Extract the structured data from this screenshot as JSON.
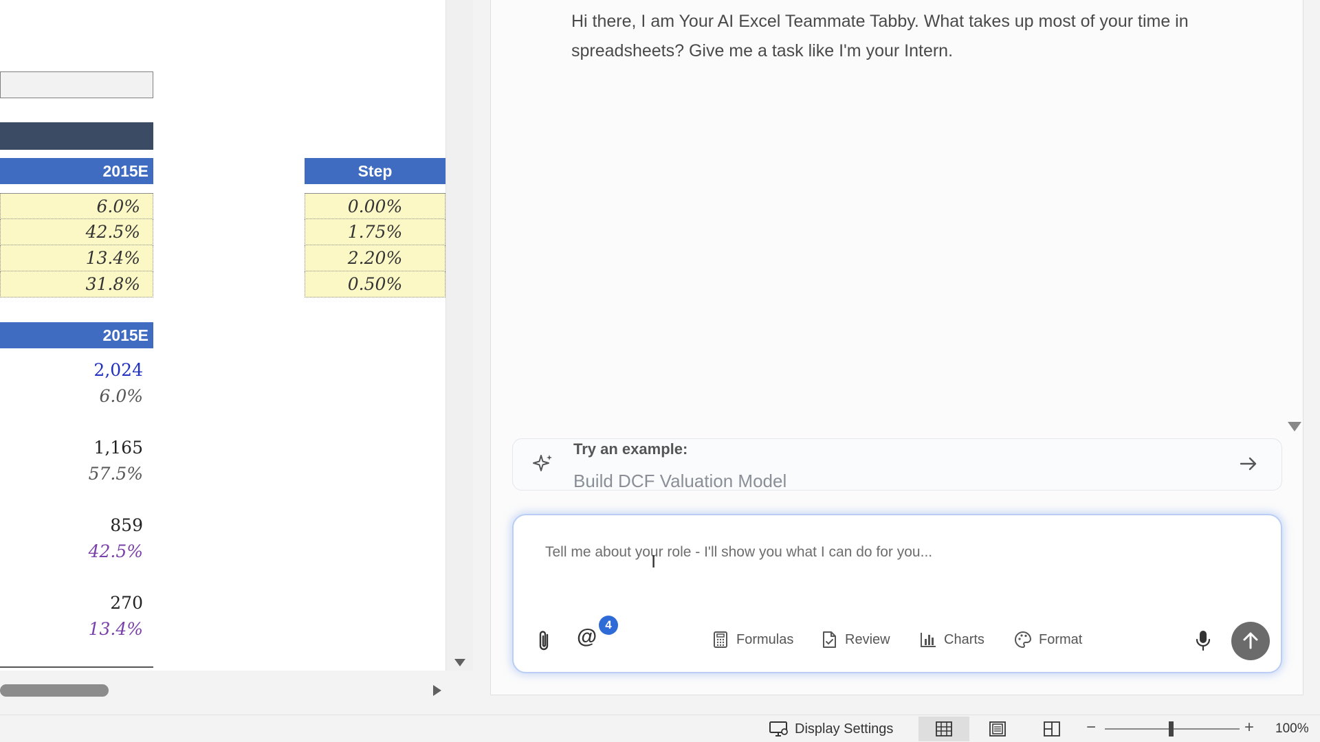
{
  "sheet": {
    "assumptions_header": "2015E",
    "step_header": "Step",
    "assumptions": [
      "6.0%",
      "42.5%",
      "13.4%",
      "31.8%"
    ],
    "steps": [
      "0.00%",
      "1.75%",
      "2.20%",
      "0.50%"
    ],
    "projection_header": "2015E",
    "projection_values": [
      {
        "value": "2,024",
        "style": "blue"
      },
      {
        "value": "6.0%",
        "style": "gray"
      },
      {
        "value": "1,165",
        "style": "black"
      },
      {
        "value": "57.5%",
        "style": "gray"
      },
      {
        "value": "859",
        "style": "black"
      },
      {
        "value": "42.5%",
        "style": "purple"
      },
      {
        "value": "270",
        "style": "black"
      },
      {
        "value": "13.4%",
        "style": "purple"
      }
    ]
  },
  "pane": {
    "greeting": "Hi there, I am Your AI Excel Teammate Tabby. What takes up most of your time in spreadsheets? Give me a task like I'm your Intern.",
    "example_label": "Try an example:",
    "example_text": "Build DCF Valuation Model",
    "input_placeholder": "Tell me about your role - I'll show you what I can do for you...",
    "mention_badge": "4",
    "tools": {
      "formulas": "Formulas",
      "review": "Review",
      "charts": "Charts",
      "format": "Format"
    }
  },
  "status": {
    "display_settings": "Display Settings",
    "zoom_minus": "−",
    "zoom_plus": "+",
    "zoom_level": "100%"
  },
  "colors": {
    "header_blue": "#3f6bc0",
    "input_yellow": "#fbf8c6",
    "dark_band": "#3b4b63",
    "badge_blue": "#2f6bd6"
  }
}
